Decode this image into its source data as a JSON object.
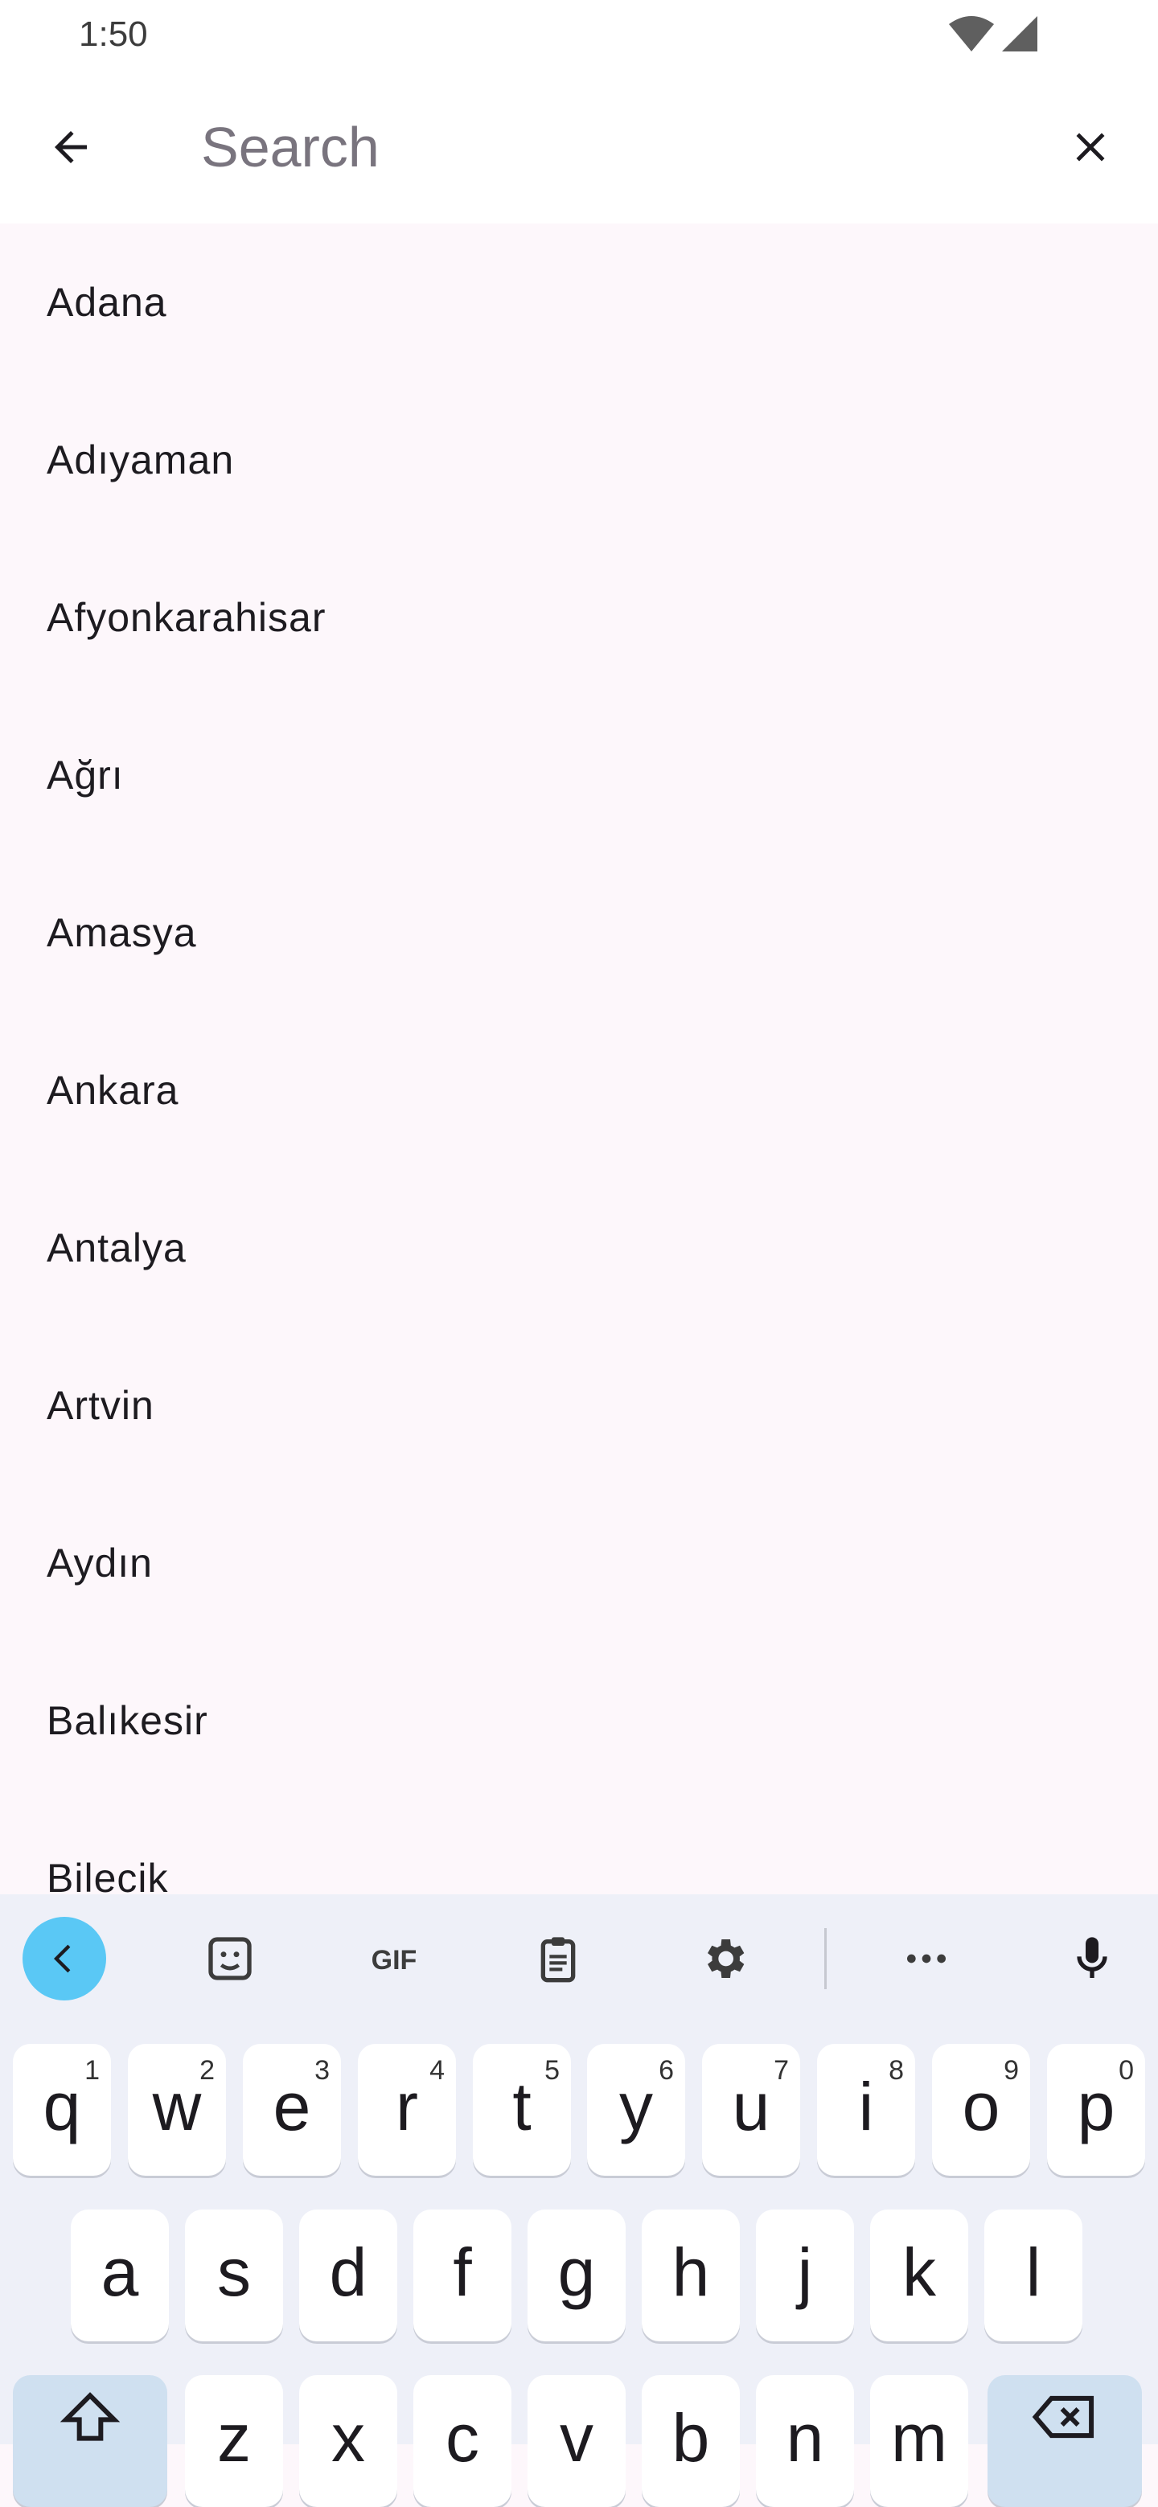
{
  "status_bar": {
    "time": "1:50"
  },
  "search": {
    "placeholder": "Search",
    "value": ""
  },
  "list": {
    "items": [
      "Adana",
      "Adıyaman",
      "Afyonkarahisar",
      "Ağrı",
      "Amasya",
      "Ankara",
      "Antalya",
      "Artvin",
      "Aydın",
      "Balıkesir",
      "Bilecik"
    ]
  },
  "keyboard": {
    "toolbar": [
      "collapse-icon",
      "sticker-icon",
      "gif-icon",
      "clipboard-icon",
      "gear-icon",
      "more-icon",
      "mic-icon"
    ],
    "row1": [
      {
        "key": "q",
        "hint": "1"
      },
      {
        "key": "w",
        "hint": "2"
      },
      {
        "key": "e",
        "hint": "3"
      },
      {
        "key": "r",
        "hint": "4"
      },
      {
        "key": "t",
        "hint": "5"
      },
      {
        "key": "y",
        "hint": "6"
      },
      {
        "key": "u",
        "hint": "7"
      },
      {
        "key": "i",
        "hint": "8"
      },
      {
        "key": "o",
        "hint": "9"
      },
      {
        "key": "p",
        "hint": "0"
      }
    ],
    "row2": [
      "a",
      "s",
      "d",
      "f",
      "g",
      "h",
      "j",
      "k",
      "l"
    ],
    "row3": [
      "z",
      "x",
      "c",
      "v",
      "b",
      "n",
      "m"
    ]
  },
  "colors": {
    "accent": "#5ac8f5",
    "background": "#fdf7fb",
    "keyboard_bg": "#eef0f8"
  }
}
